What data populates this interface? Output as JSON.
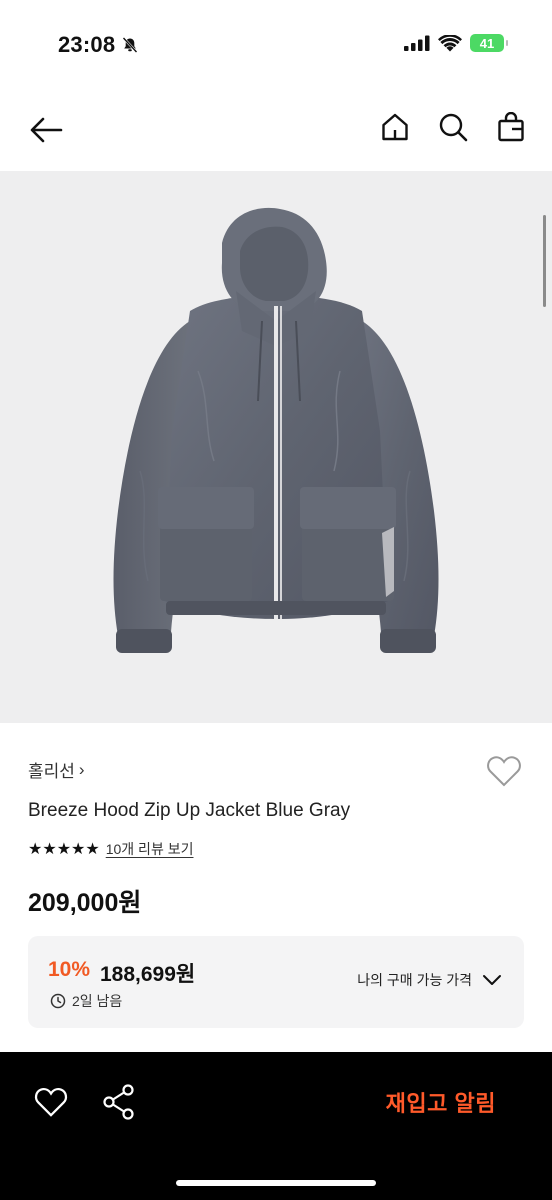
{
  "status_bar": {
    "time": "23:08",
    "battery": "41",
    "icons": [
      "bell-slash-icon",
      "cellular-signal-icon",
      "wifi-icon",
      "battery-icon"
    ]
  },
  "nav": {
    "icons": [
      "back-arrow-icon",
      "home-icon",
      "search-icon",
      "shopping-bag-icon"
    ]
  },
  "product": {
    "brand": "홀리선",
    "brand_chevron": "›",
    "name": "Breeze Hood Zip Up Jacket Blue Gray",
    "stars": "★★★★★",
    "rating_stars": 5,
    "review_link": "10개 리뷰 보기",
    "price": "209,000원",
    "image_subject": "blue gray nylon hooded zip-up jacket"
  },
  "coupon": {
    "rate": "10%",
    "price": "188,699원",
    "time_left": "2일 남음",
    "cta": "나의 구매 가능 가격"
  },
  "bottom_bar": {
    "restock_label": "재입고 알림",
    "icons": [
      "heart-icon",
      "share-icon"
    ]
  },
  "colors": {
    "accent": "#f15a24",
    "restock": "#ff5a2a",
    "hero_bg": "#eeeeef",
    "coupon_bg": "#f4f4f5"
  }
}
